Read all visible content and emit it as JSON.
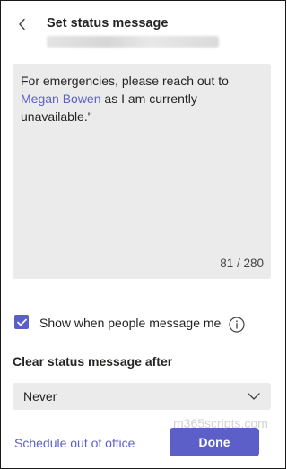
{
  "header": {
    "back_icon": "chevron-left-icon",
    "title": "Set status message"
  },
  "message": {
    "text_before": "For emergencies, please reach out to ",
    "mention": "Megan Bowen",
    "text_after": " as I am currently unavailable.\"",
    "counter": "81 / 280"
  },
  "options": {
    "show_when_messaged_label": "Show when people message me",
    "show_when_messaged_checked": true,
    "info_icon": "info-icon"
  },
  "clear_after": {
    "heading": "Clear status message after",
    "selected": "Never",
    "dropdown_icon": "chevron-down-icon"
  },
  "footer": {
    "schedule_link": "Schedule out of office",
    "done_label": "Done"
  },
  "watermark": "m365scripts.com",
  "colors": {
    "accent": "#5b5fc7",
    "field_background": "#ebebeb",
    "text": "#252423"
  }
}
